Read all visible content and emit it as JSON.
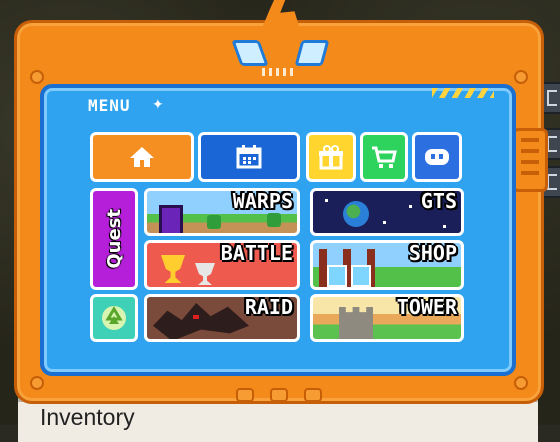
{
  "menu": {
    "title": "MENU"
  },
  "buttons": {
    "home": "home",
    "calendar": "calendar",
    "gift": "gift",
    "cart": "cart",
    "discord": "discord",
    "recycle": "recycle"
  },
  "quest": {
    "label": "Quest"
  },
  "tiles": {
    "warps": "WARPS",
    "gts": "GTS",
    "battle": "BATTLE",
    "shop": "SHOP",
    "raid": "RAID",
    "tower": "TOWER"
  },
  "inventory": {
    "label": "Inventory"
  },
  "colors": {
    "frame": "#f38a1a",
    "screen": "#2fa3ef",
    "home": "#f58f22",
    "calendar": "#1a66d6",
    "gift": "#ffd52e",
    "cart": "#2ed35e",
    "discord": "#2c6fe0",
    "quest": "#b51fd9",
    "recycle": "#3fd1b8"
  }
}
